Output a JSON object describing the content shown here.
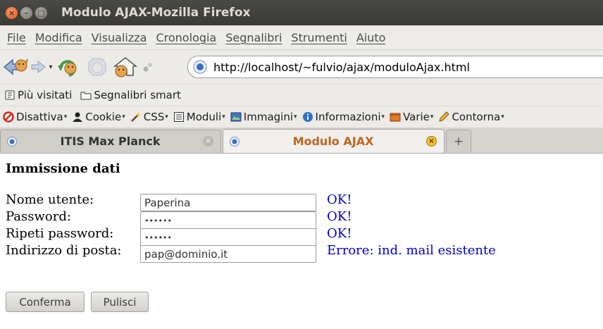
{
  "window": {
    "title": "Modulo AJAX-Mozilla Firefox"
  },
  "menubar": {
    "items": [
      "File",
      "Modifica",
      "Visualizza",
      "Cronologia",
      "Segnalibri",
      "Strumenti",
      "Aiuto"
    ]
  },
  "navbar": {
    "url": "http://localhost/~fulvio/ajax/moduloAjax.html"
  },
  "bookmarks": {
    "items": [
      "Più visitati",
      "Segnalibri smart"
    ]
  },
  "devtoolbar": {
    "items": [
      "Disattiva",
      "Cookie",
      "CSS",
      "Moduli",
      "Immagini",
      "Informazioni",
      "Varie",
      "Contorna"
    ]
  },
  "tabs": {
    "items": [
      {
        "label": "ITIS Max Planck"
      },
      {
        "label": "Modulo AJAX"
      }
    ],
    "new_tab": "+"
  },
  "page": {
    "heading": "Immissione dati",
    "fields": [
      {
        "label": "Nome utente:",
        "value": "Paperina",
        "status": "OK!"
      },
      {
        "label": "Password:",
        "value": "••••••",
        "status": "OK!"
      },
      {
        "label": "Ripeti password:",
        "value": "••••••",
        "status": "OK!"
      },
      {
        "label": "Indirizzo di posta:",
        "value": "pap@dominio.it",
        "status": "Errore: ind. mail esistente"
      }
    ],
    "buttons": {
      "confirm": "Conferma",
      "clear": "Pulisci"
    }
  },
  "colors": {
    "status_text": "#0000cc",
    "active_tab_label": "#c1641c",
    "titlebar": "#3c3b37"
  }
}
